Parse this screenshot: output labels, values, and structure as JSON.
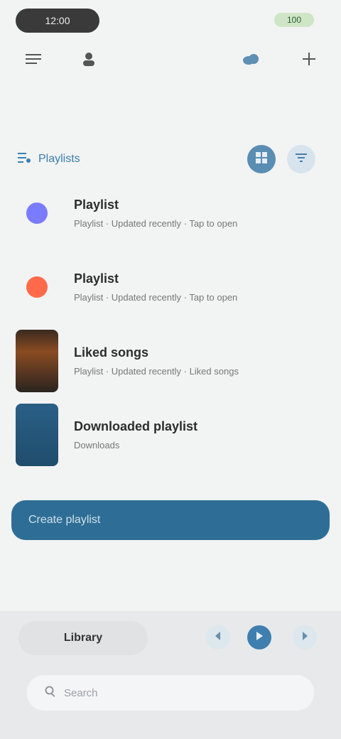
{
  "status": {
    "time": "12:00",
    "battery": "100"
  },
  "header": {
    "section_label": "Playlists"
  },
  "list": [
    {
      "title": "Playlist",
      "subtitle": "Playlist · Updated recently · Tap to open",
      "accent": "#7b7bff"
    },
    {
      "title": "Playlist",
      "subtitle": "Playlist · Updated recently · Tap to open",
      "accent": "#ff6b4a"
    },
    {
      "title": "Liked songs",
      "subtitle": "Playlist · Updated recently · Liked songs",
      "accent": "#6a3f26"
    },
    {
      "title": "Downloaded playlist",
      "subtitle": "Downloads",
      "accent": "#2b5f86"
    }
  ],
  "action": {
    "label": "Create playlist"
  },
  "bottom": {
    "tab_label": "Library",
    "search_placeholder": "Search"
  },
  "icons": {
    "top_left_1": "list-icon",
    "top_left_2": "person-icon",
    "top_right_1": "cloud-icon",
    "top_right_2": "plus-icon",
    "section": "playlist-icon",
    "hdr_primary": "grid-icon",
    "hdr_secondary": "sort-icon"
  },
  "colors": {
    "primary": "#2e6e96",
    "accent": "#3a7fb2",
    "background": "#f2f3f3"
  }
}
